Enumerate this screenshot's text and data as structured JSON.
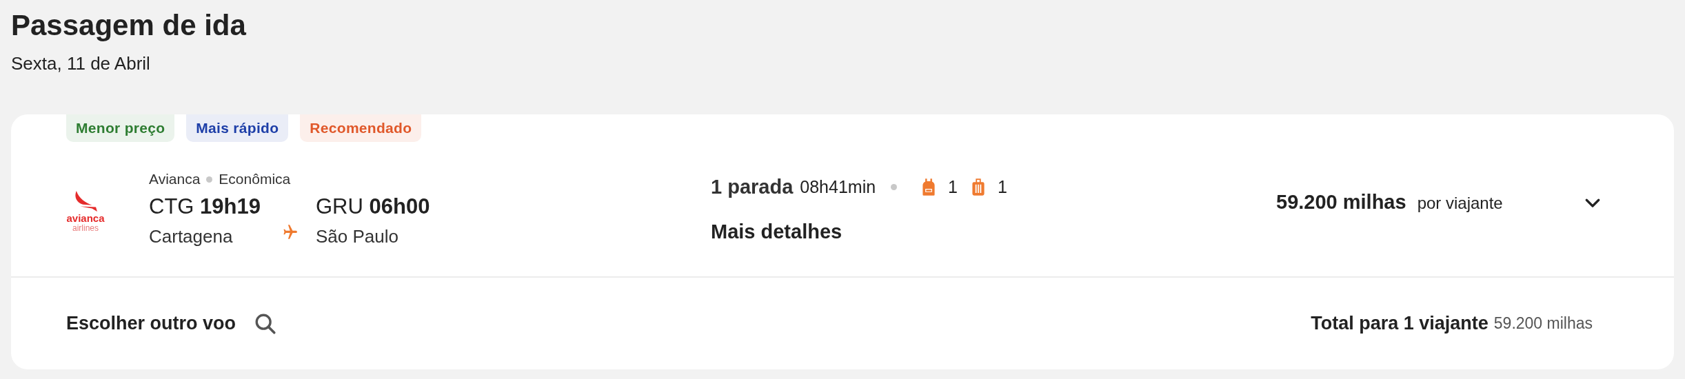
{
  "header": {
    "title": "Passagem de ida",
    "date": "Sexta, 11 de Abril"
  },
  "card": {
    "badges": [
      {
        "label": "Menor preço",
        "color": "#2e7d32"
      },
      {
        "label": "Mais rápido",
        "color": "#1e3fa8"
      },
      {
        "label": "Recomendado",
        "color": "#e0582a"
      }
    ],
    "logo": {
      "name": "avianca",
      "sub": "airlines"
    },
    "airline": "Avianca",
    "cabin": "Econômica",
    "departure": {
      "code": "CTG",
      "time": "19h19",
      "city": "Cartagena"
    },
    "arrival": {
      "code": "GRU",
      "time": "06h00",
      "city": "São Paulo"
    },
    "stops": "1 parada",
    "duration": "08h41min",
    "baggage": [
      {
        "kind": "backpack",
        "count": "1"
      },
      {
        "kind": "suitcase",
        "count": "1"
      }
    ],
    "details_link": "Mais detalhes",
    "price": "59.200 milhas",
    "price_unit": "por viajante",
    "expanded": false
  },
  "footer": {
    "choose_other": "Escolher outro voo",
    "total_label": "Total para 1 viajante",
    "total_value": "59.200 milhas"
  }
}
